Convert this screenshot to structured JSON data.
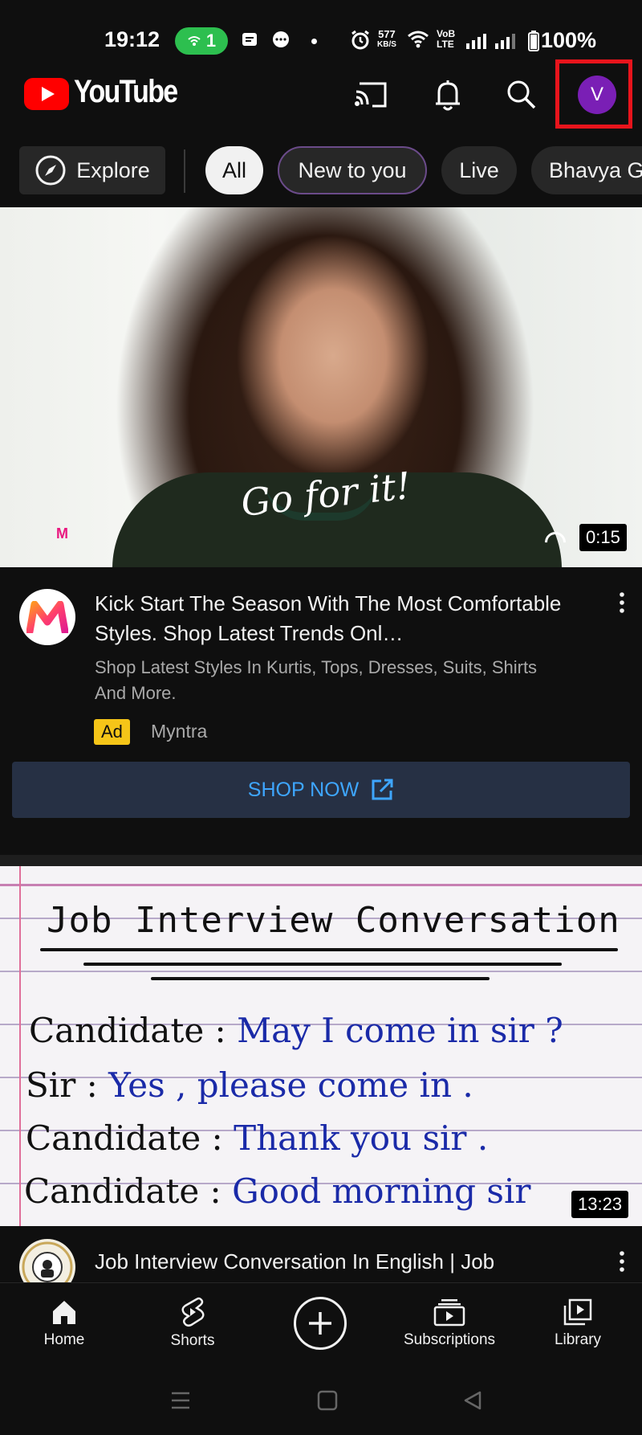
{
  "status_bar": {
    "time": "19:12",
    "hotspot_count": "1",
    "net_speed_top": "577",
    "net_speed_unit": "KB/S",
    "volte_top": "VoB",
    "volte_bottom": "LTE",
    "battery": "100%"
  },
  "app_bar": {
    "logo_text": "YouTube",
    "avatar_initial": "V"
  },
  "chips": {
    "explore": "Explore",
    "items": [
      "All",
      "New to you",
      "Live",
      "Bhavya G"
    ]
  },
  "ad": {
    "tagline": "Go for it!",
    "thumb_logo": "M",
    "duration": "0:15",
    "title": "Kick Start The Season With The Most Comfortable Styles. Shop Latest Trends Onl…",
    "description": "Shop Latest Styles In Kurtis, Tops, Dresses, Suits, Shirts And More.",
    "badge": "Ad",
    "advertiser": "Myntra",
    "cta": "SHOP NOW"
  },
  "video": {
    "heading": "Job Interview Conversation",
    "lines": [
      {
        "speaker": "Candidate :",
        "speech": "May I come in sir ?"
      },
      {
        "speaker": "Sir :",
        "speech": "Yes , please come in ."
      },
      {
        "speaker": "Candidate :",
        "speech": "Thank you sir ."
      },
      {
        "speaker": "Candidate :",
        "speech": "Good morning sir"
      }
    ],
    "duration": "13:23",
    "title": "Job Interview Conversation In English | Job"
  },
  "bottom_nav": {
    "home": "Home",
    "shorts": "Shorts",
    "subscriptions": "Subscriptions",
    "library": "Library"
  },
  "colors": {
    "background": "#0f0f0f",
    "youtube_red": "#ff0000",
    "avatar": "#7a1fb5",
    "highlight_box": "#e8141c",
    "link_blue": "#3ea6ff",
    "ad_badge": "#f5c518"
  }
}
